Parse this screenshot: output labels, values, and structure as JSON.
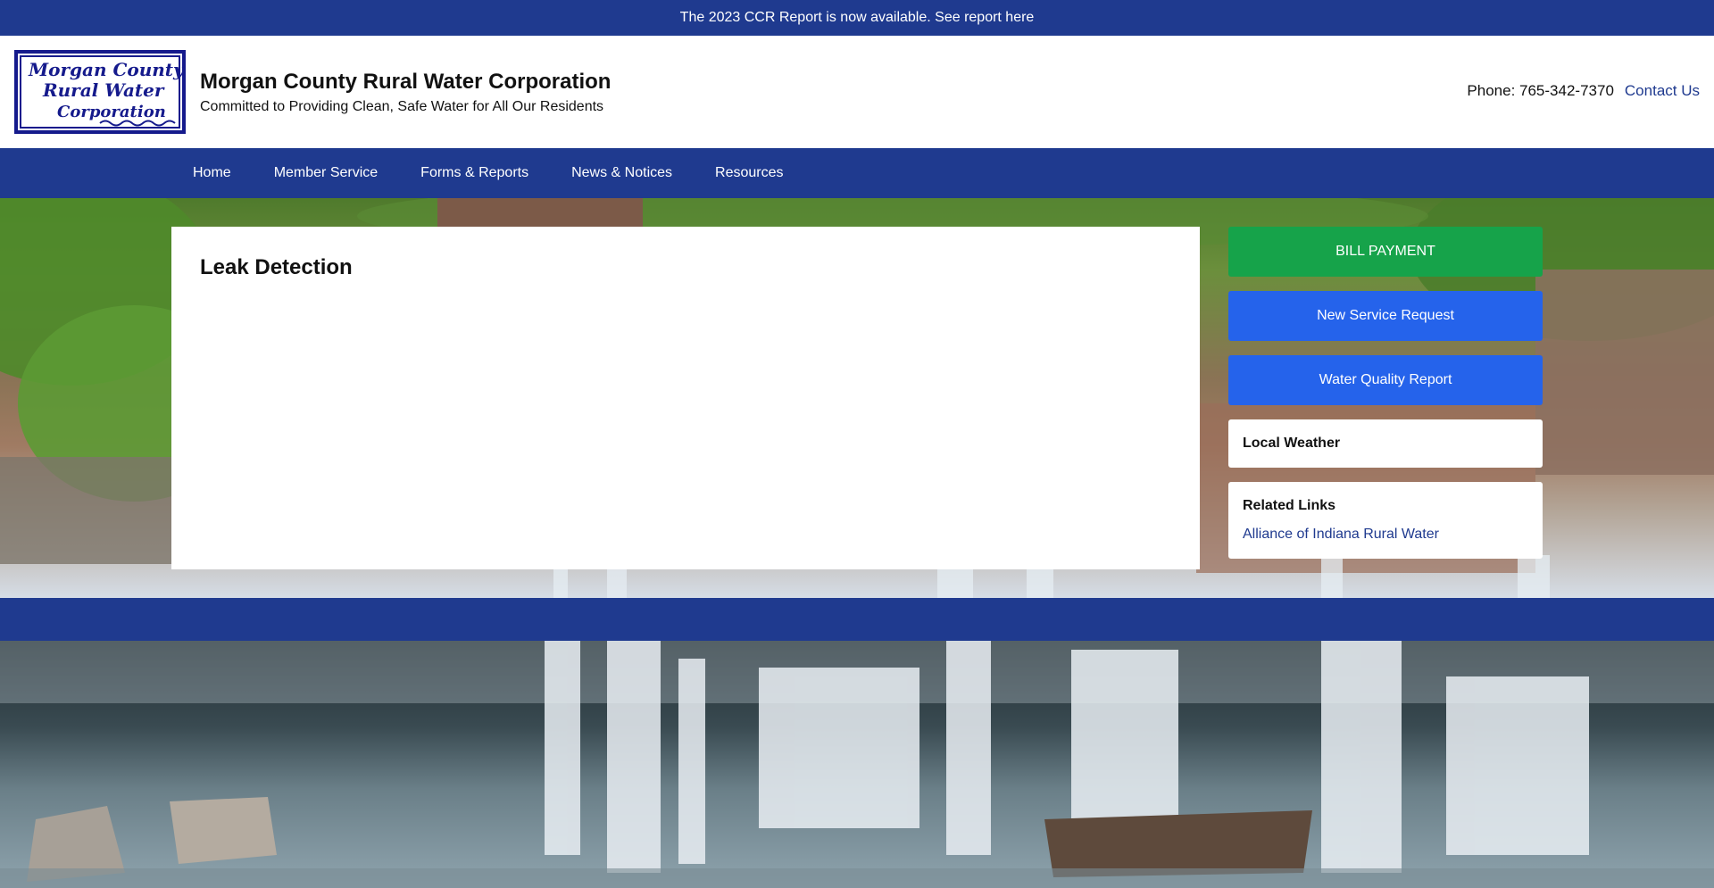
{
  "announcement": {
    "text": "The 2023 CCR Report is now available. See report here"
  },
  "header": {
    "title": "Morgan County Rural Water Corporation",
    "tagline": "Committed to Providing Clean, Safe Water for All Our Residents",
    "logo_lines": [
      "Morgan County",
      "Rural Water",
      "Corporation"
    ],
    "phone": "Phone: 765-342-7370",
    "contact_link": "Contact Us"
  },
  "nav": {
    "items": [
      {
        "label": "Home"
      },
      {
        "label": "Member Service"
      },
      {
        "label": "Forms & Reports"
      },
      {
        "label": "News & Notices"
      },
      {
        "label": "Resources"
      }
    ]
  },
  "main": {
    "title": "Leak Detection"
  },
  "sidebar": {
    "buttons": {
      "bill_payment": "BILL PAYMENT",
      "new_service": "New Service Request",
      "water_quality": "Water Quality Report"
    },
    "weather": {
      "title": "Local Weather"
    },
    "related": {
      "title": "Related Links",
      "links": [
        {
          "label": "Alliance of Indiana Rural Water"
        }
      ]
    }
  },
  "colors": {
    "brand_blue": "#1f3a8f",
    "bill_green": "#16a34a",
    "action_blue": "#2563eb"
  }
}
